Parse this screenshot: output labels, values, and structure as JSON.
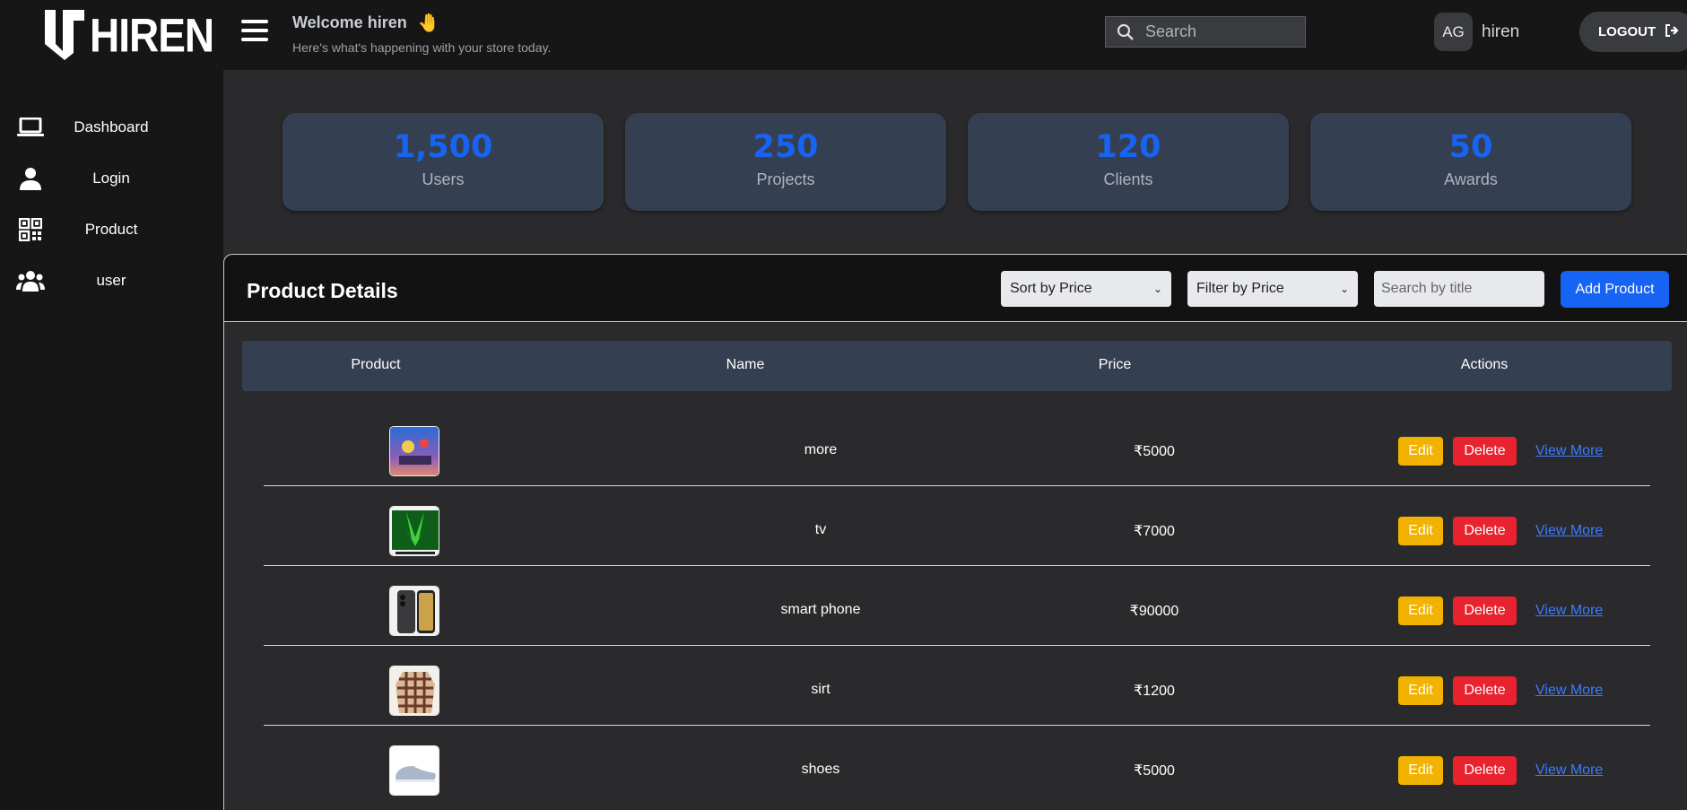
{
  "brand": {
    "name": "HIREN"
  },
  "sidebar": {
    "items": [
      {
        "label": "Dashboard",
        "icon": "laptop-icon"
      },
      {
        "label": "Login",
        "icon": "user-icon"
      },
      {
        "label": "Product",
        "icon": "qr-code-icon"
      },
      {
        "label": "user",
        "icon": "users-icon"
      }
    ]
  },
  "header": {
    "welcome": "Welcome hiren",
    "wave": "🤚",
    "subtitle": "Here's what's happening with your store today.",
    "search_placeholder": "Search",
    "avatar_initials": "AG",
    "username": "hiren",
    "logout_label": "LOGOUT"
  },
  "stats": [
    {
      "value": "1,500",
      "label": "Users"
    },
    {
      "value": "250",
      "label": "Projects"
    },
    {
      "value": "120",
      "label": "Clients"
    },
    {
      "value": "50",
      "label": "Awards"
    }
  ],
  "products": {
    "title": "Product Details",
    "sort_label": "Sort by Price",
    "filter_label": "Filter by Price",
    "search_placeholder": "Search by title",
    "add_label": "Add Product",
    "columns": [
      "Product",
      "Name",
      "Price",
      "Actions"
    ],
    "rows": [
      {
        "name": "more",
        "price": "₹5000"
      },
      {
        "name": "tv",
        "price": "₹7000"
      },
      {
        "name": "smart phone",
        "price": "₹90000"
      },
      {
        "name": "sirt",
        "price": "₹1200"
      },
      {
        "name": "shoes",
        "price": "₹5000"
      }
    ],
    "edit_label": "Edit",
    "delete_label": "Delete",
    "view_more_label": "View More"
  },
  "colors": {
    "accent": "#1763f4",
    "edit": "#f2b200",
    "delete": "#e8222f",
    "card": "#353f52"
  }
}
